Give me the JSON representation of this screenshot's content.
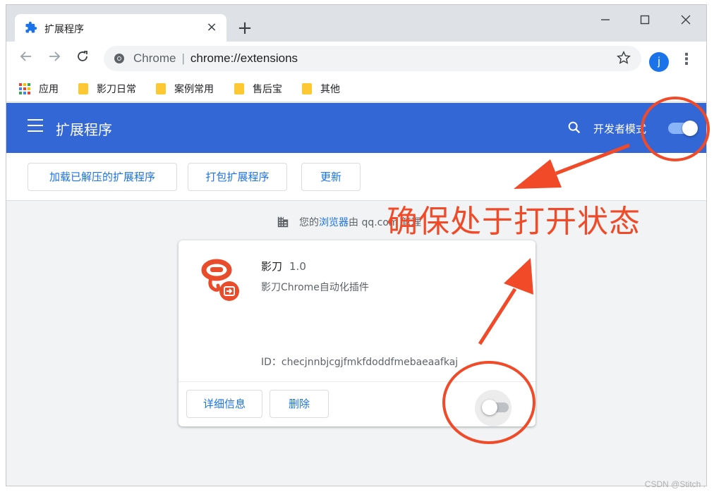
{
  "browser": {
    "tab_title": "扩展程序",
    "tab_close": "×",
    "new_tab": "+",
    "window_controls": {
      "minimize": "—",
      "maximize": "☐",
      "close": "✕"
    },
    "omnibox": {
      "site": "Chrome",
      "separator": "|",
      "url": "chrome://extensions"
    },
    "avatar_letter": "j",
    "bookmarks": [
      {
        "label": "应用",
        "icon": "apps-grid-icon"
      },
      {
        "label": "影刀日常",
        "icon": "folder-icon"
      },
      {
        "label": "案例常用",
        "icon": "folder-icon"
      },
      {
        "label": "售后宝",
        "icon": "folder-icon"
      },
      {
        "label": "其他",
        "icon": "folder-icon"
      }
    ]
  },
  "header": {
    "title": "扩展程序",
    "dev_mode_label": "开发者模式",
    "dev_mode_on": true
  },
  "actions": {
    "load_unpacked": "加载已解压的扩展程序",
    "pack": "打包扩展程序",
    "update": "更新"
  },
  "managed": {
    "prefix": "您的",
    "link": "浏览器",
    "suffix": "由 qq.com 管理"
  },
  "extension": {
    "name": "影刀",
    "version": "1.0",
    "description": "影刀Chrome自动化插件",
    "id_label": "ID：",
    "id": "checjnnbjcgjfmkfdoddfmebaeaafkaj",
    "details_button": "详细信息",
    "remove_button": "删除",
    "enabled": false
  },
  "annotation": {
    "text": "确保处于打开状态",
    "color": "#f04a28"
  },
  "watermark": "CSDN @Stitch .",
  "colors": {
    "header_blue": "#3367d6",
    "link_blue": "#1a73e8",
    "annotation_red": "#f04a28",
    "folder_yellow": "#fcc934"
  }
}
